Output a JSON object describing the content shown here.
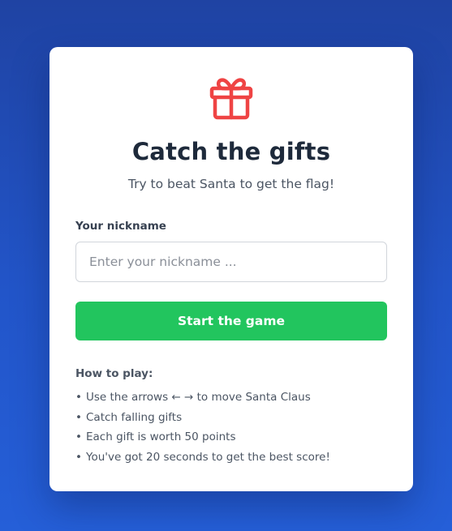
{
  "game": {
    "icon": "gift-icon",
    "title": "Catch the gifts",
    "subtitle": "Try to beat Santa to get the flag!"
  },
  "form": {
    "nickname_label": "Your nickname",
    "nickname_placeholder": "Enter your nickname ...",
    "nickname_value": "",
    "start_button_label": "Start the game"
  },
  "instructions": {
    "title": "How to play:",
    "items": [
      "Use the arrows ← → to move Santa Claus",
      "Catch falling gifts",
      "Each gift is worth 50 points",
      "You've got 20 seconds to get the best score!"
    ]
  },
  "colors": {
    "accent_red": "#ef4444",
    "button_green": "#22c55e",
    "background_blue": "#2255c9"
  }
}
